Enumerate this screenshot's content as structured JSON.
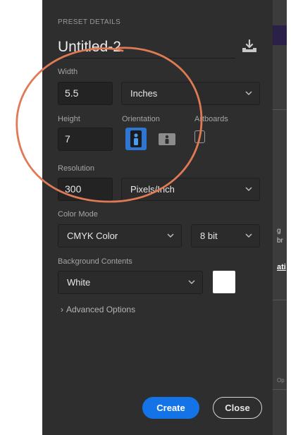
{
  "preset": {
    "section_title": "PRESET DETAILS",
    "document_name": "Untitled-2"
  },
  "width": {
    "label": "Width",
    "value": "5.5",
    "unit": "Inches"
  },
  "height": {
    "label": "Height",
    "value": "7"
  },
  "orientation": {
    "label": "Orientation",
    "selected": "portrait"
  },
  "artboards": {
    "label": "Artboards",
    "checked": false
  },
  "resolution": {
    "label": "Resolution",
    "value": "300",
    "unit": "Pixels/Inch"
  },
  "color_mode": {
    "label": "Color Mode",
    "mode": "CMYK Color",
    "depth": "8 bit"
  },
  "background": {
    "label": "Background Contents",
    "value": "White",
    "swatch_color": "#ffffff"
  },
  "advanced": {
    "label": "Advanced Options"
  },
  "actions": {
    "create_label": "Create",
    "close_label": "Close"
  },
  "colors": {
    "accent": "#1473e6",
    "panel": "#2e2e2e",
    "annotation": "#e07a55"
  },
  "background_window": {
    "fragments": [
      "g",
      "br",
      "ati",
      "Op"
    ]
  }
}
